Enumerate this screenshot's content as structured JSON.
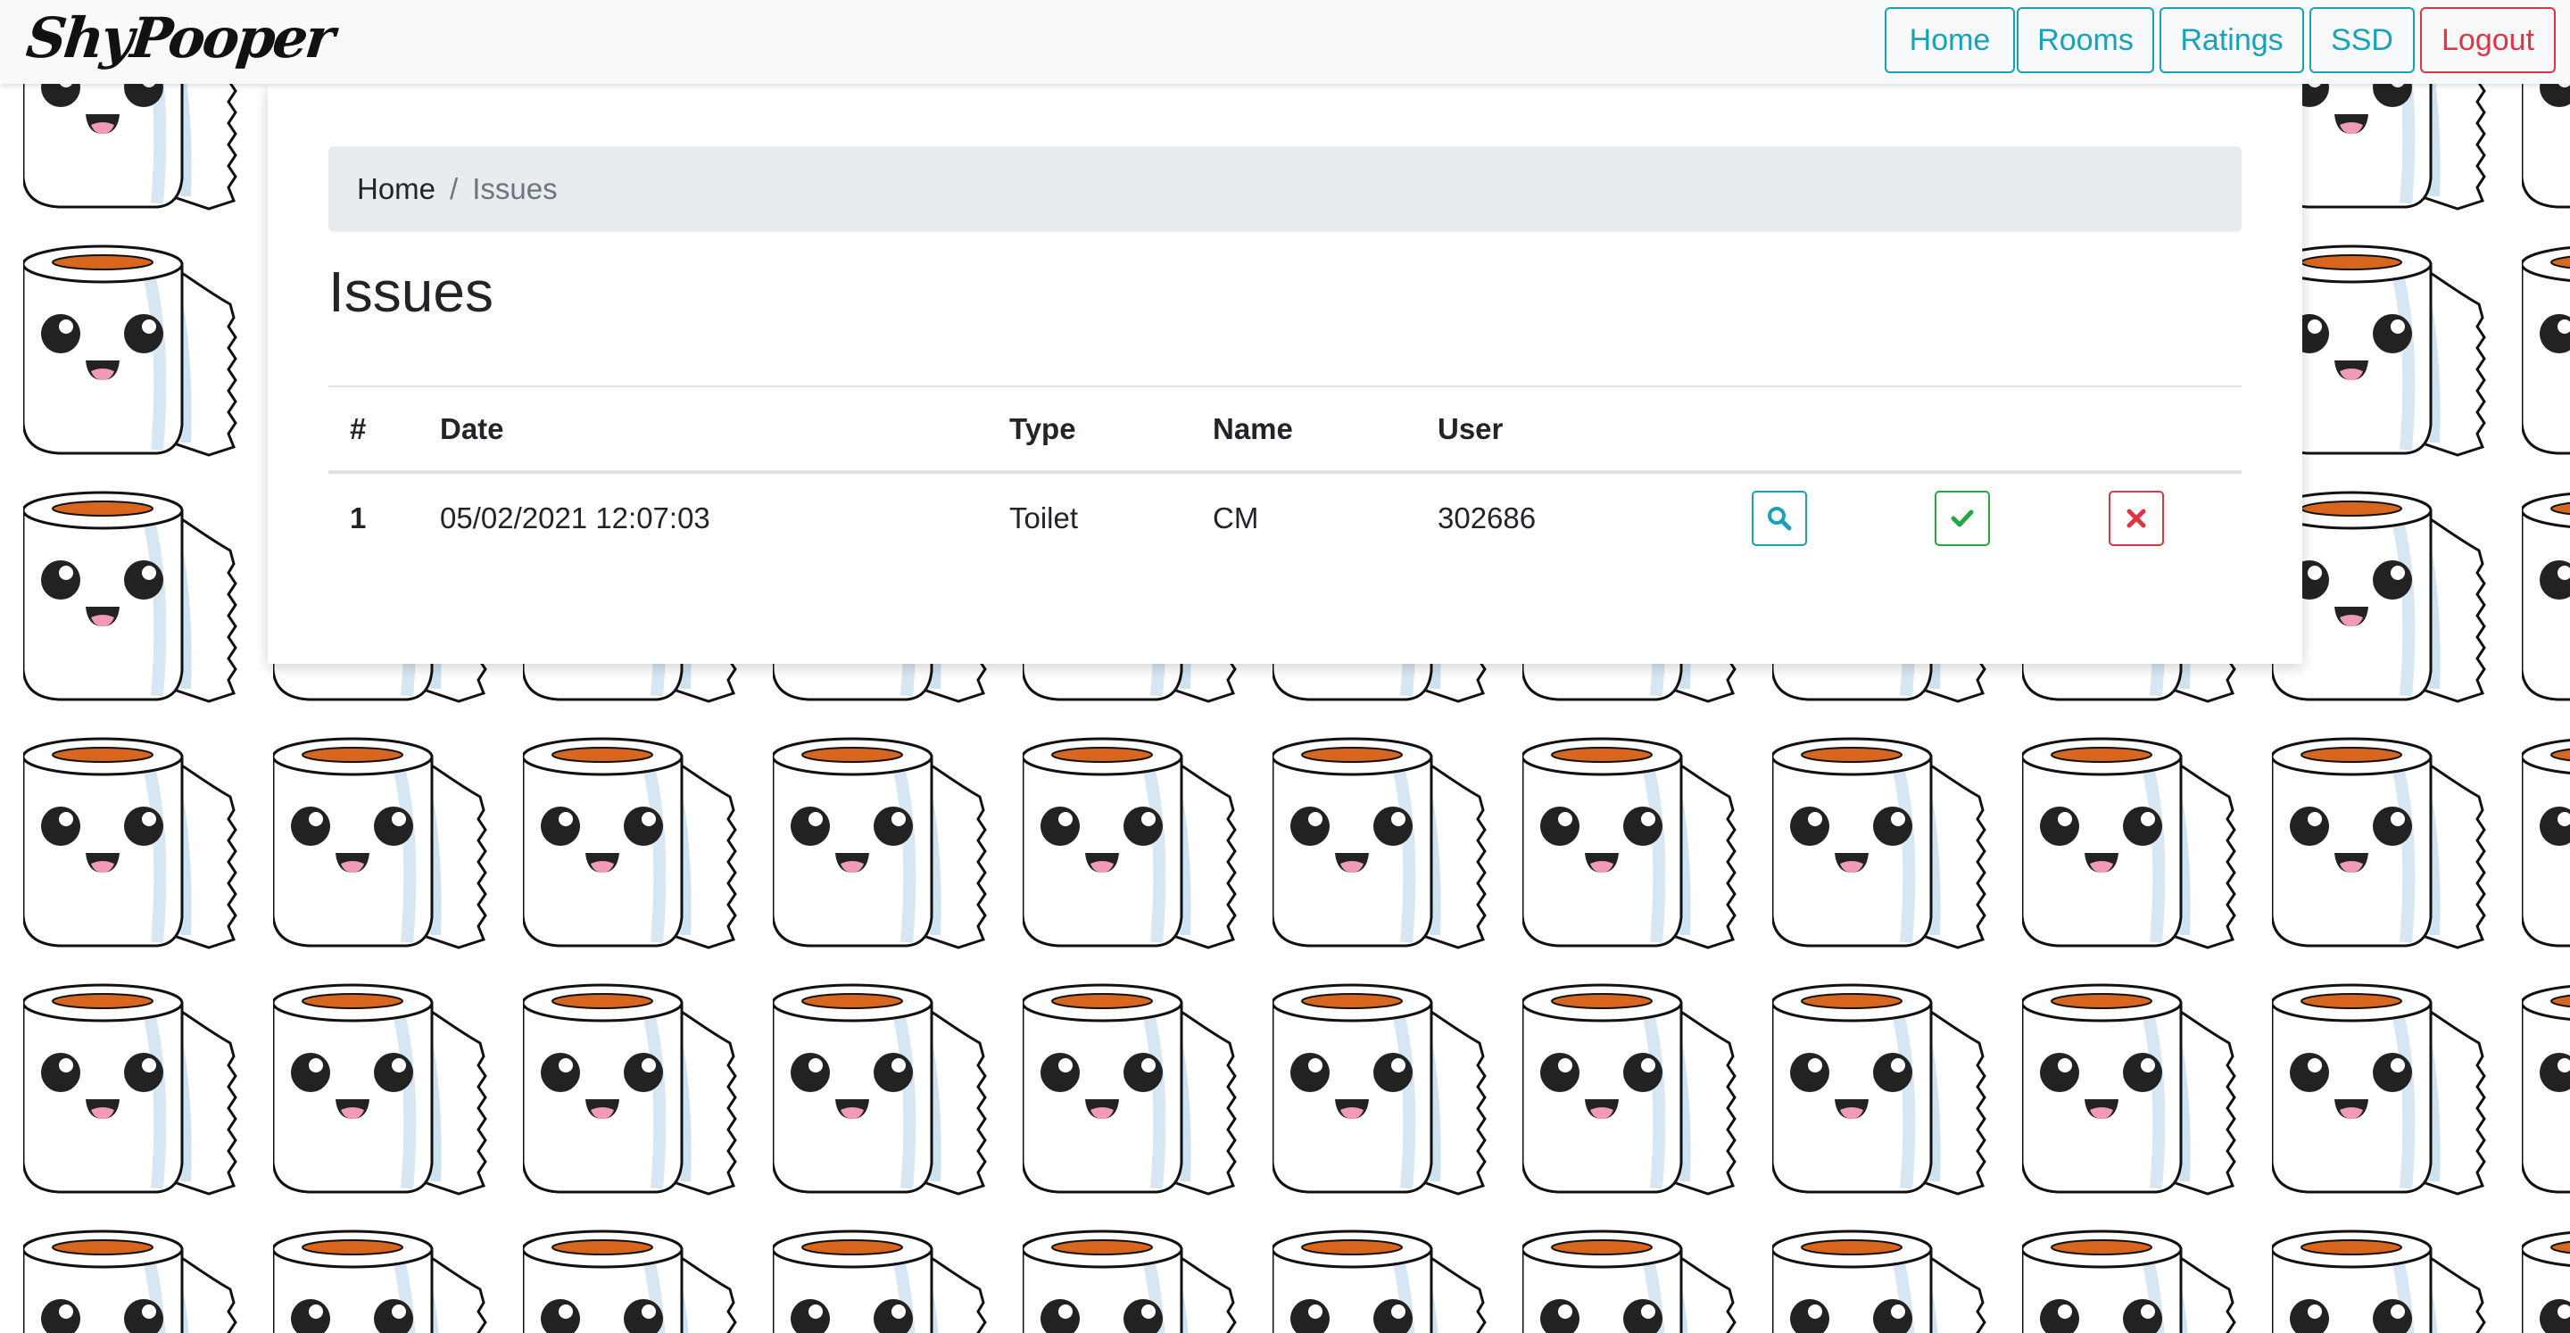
{
  "navbar": {
    "brand": "ShyPooper",
    "items": [
      {
        "label": "Home"
      },
      {
        "label": "Rooms"
      },
      {
        "label": "Ratings"
      },
      {
        "label": "SSD"
      },
      {
        "label": "Logout"
      }
    ]
  },
  "breadcrumb": {
    "home": "Home",
    "separator": "/",
    "current": "Issues"
  },
  "page": {
    "title": "Issues"
  },
  "table": {
    "headers": [
      "#",
      "Date",
      "Type",
      "Name",
      "User"
    ],
    "rows": [
      {
        "num": "1",
        "date": "05/02/2021 12:07:03",
        "type": "Toilet",
        "name": "CM",
        "user": "302686",
        "actions": {
          "view_icon": "search-icon",
          "approve_icon": "check-icon",
          "delete_icon": "close-icon"
        }
      }
    ]
  },
  "colors": {
    "info": "#17a2b8",
    "success": "#28a745",
    "danger": "#dc3545",
    "navbar_bg": "#f8f9fa",
    "breadcrumb_bg": "#e9ecef"
  }
}
